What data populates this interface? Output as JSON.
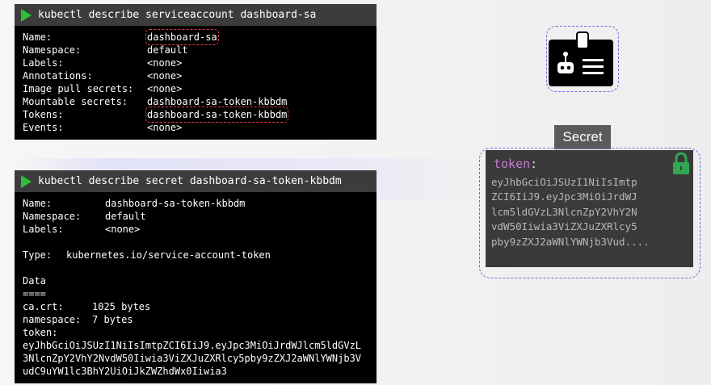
{
  "terminal1": {
    "command": "kubectl describe serviceaccount dashboard-sa",
    "rows": [
      {
        "key": "Name:",
        "value": "dashboard-sa"
      },
      {
        "key": "Namespace:",
        "value": "default"
      },
      {
        "key": "Labels:",
        "value": "<none>"
      },
      {
        "key": "Annotations:",
        "value": "<none>"
      },
      {
        "key": "Image pull secrets:",
        "value": "<none>"
      },
      {
        "key": "Mountable secrets:",
        "value": "dashboard-sa-token-kbbdm"
      },
      {
        "key": "Tokens:",
        "value": "dashboard-sa-token-kbbdm"
      },
      {
        "key": "Events:",
        "value": "<none>"
      }
    ]
  },
  "terminal2": {
    "command": "kubectl describe secret dashboard-sa-token-kbbdm",
    "meta": [
      {
        "key": "Name:",
        "value": "dashboard-sa-token-kbbdm"
      },
      {
        "key": "Namespace:",
        "value": "default"
      },
      {
        "key": "Labels:",
        "value": "<none>"
      }
    ],
    "type_key": "Type:",
    "type_value": "kubernetes.io/service-account-token",
    "data_title": "Data",
    "data_rule": "====",
    "data": [
      {
        "key": "ca.crt:",
        "value": "1025 bytes"
      },
      {
        "key": "namespace:",
        "value": "7 bytes"
      }
    ],
    "token_key": "token:",
    "token_lines": [
      "eyJhbGciOiJSUzI1NiIsImtpZCI6IiJ9.eyJpc3MiOiJrdWJlcm5ldGVzL",
      "3NlcnZpY2VhY2NvdW50Iiwia3ViZXJuZXRlcy5pby9zZXJ2aWNlYWNjb3V",
      "udC9uYW1lc3BhY2UiOiJkZWZhdWx0Iiwia3"
    ]
  },
  "secret": {
    "tab_label": "Secret",
    "token_key": "token",
    "token_colon": ":",
    "token_lines": [
      "eyJhbGciOiJSUzI1NiIsImtp",
      "ZCI6IiJ9.eyJpc3MiOiJrdWJ",
      "lcm5ldGVzL3NlcnZpY2VhY2N",
      "vdW50Iiwia3ViZXJuZXRlcy5",
      "pby9zZXJ2aWNlYWNjb3Vud...."
    ],
    "lock_color": "#2fa84f"
  }
}
